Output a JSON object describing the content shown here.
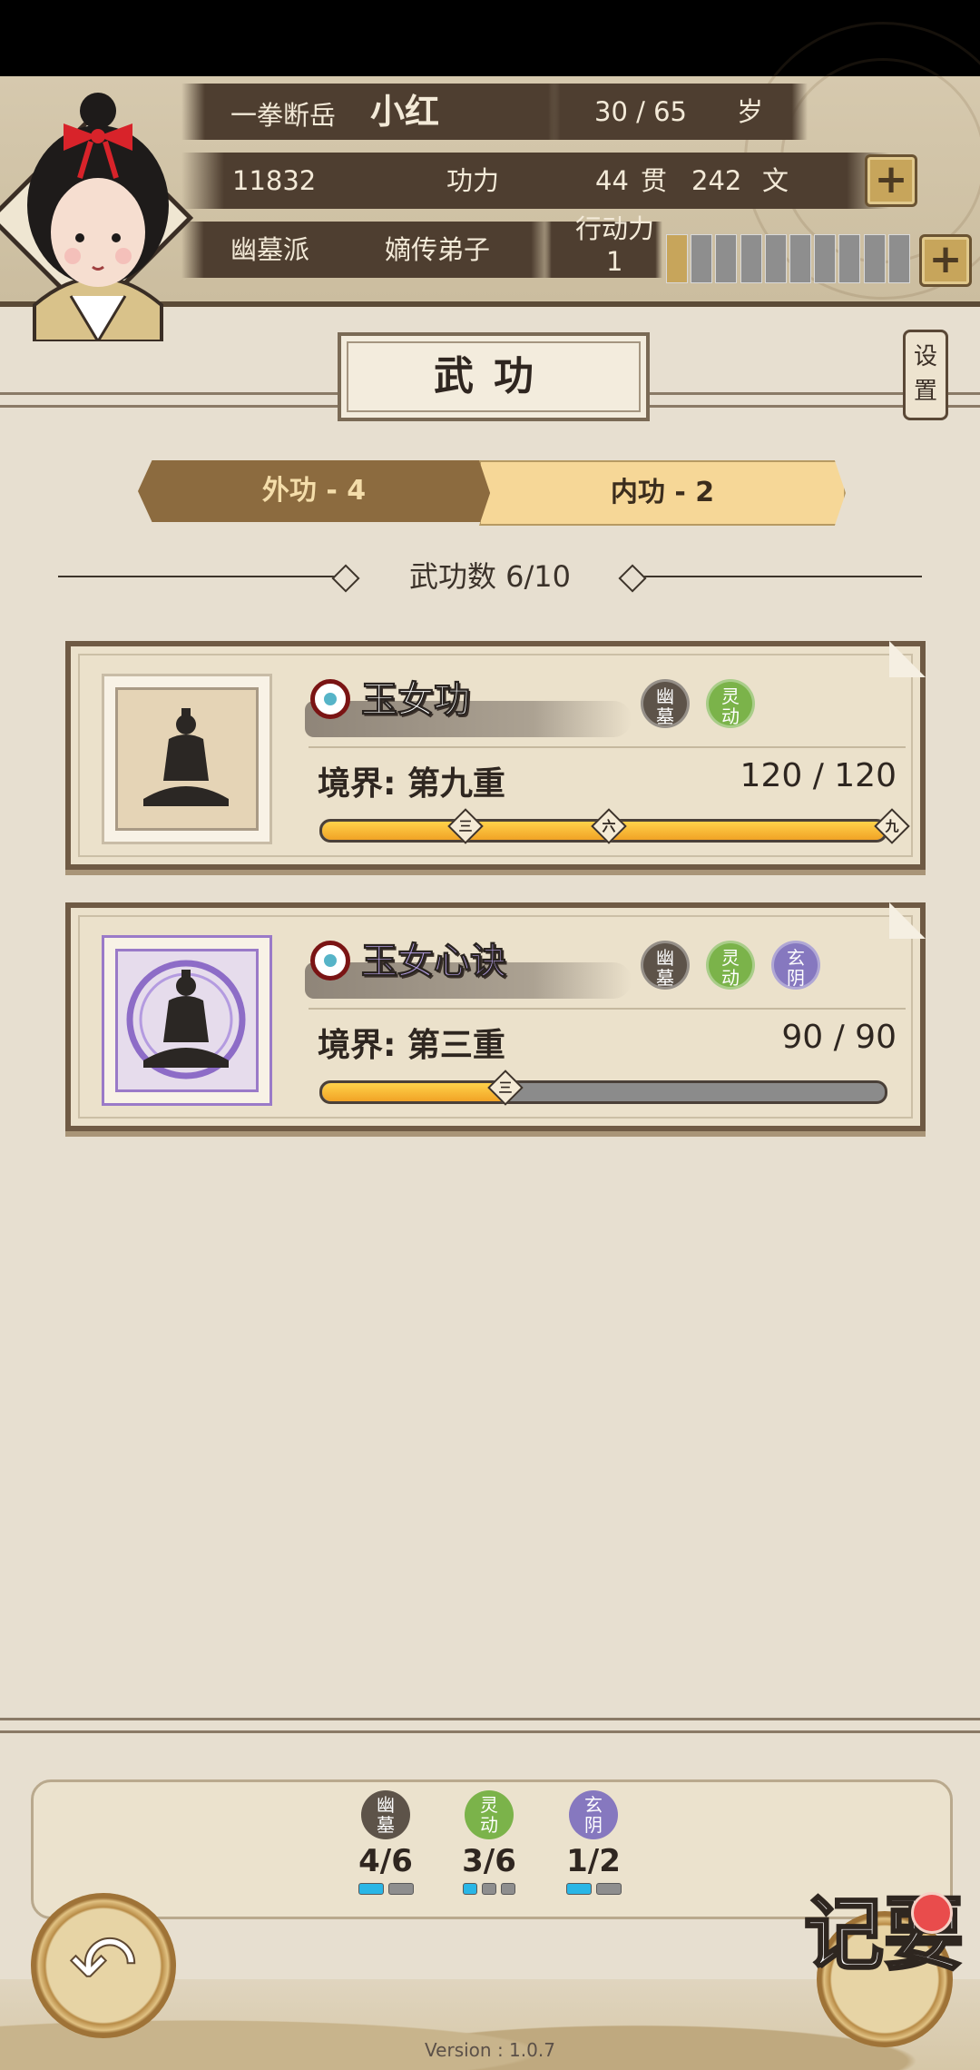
{
  "header": {
    "title": "一拳断岳",
    "name": "小红",
    "age": "30 / 65",
    "age_unit": "岁",
    "power_value": "11832",
    "power_label": "功力",
    "money_guan": "44",
    "guan_unit": "贯",
    "money_wen": "242",
    "wen_unit": "文",
    "sect": "幽墓派",
    "rank": "嫡传弟子",
    "action_label": "行动力",
    "action_value": "1",
    "action_cells_total": 10,
    "action_cells_filled": 1,
    "plus_symbol": "+"
  },
  "settings_label": "设置",
  "page_title": "武功",
  "tabs": [
    {
      "label": "外功 - 4",
      "active": false
    },
    {
      "label": "内功 - 2",
      "active": true
    }
  ],
  "skill_count": "武功数 6/10",
  "skills": [
    {
      "name": "玉女功",
      "name_color": "#ffffff",
      "badges": [
        {
          "label": "幽墓",
          "color": "#5d5349"
        },
        {
          "label": "灵动",
          "color": "#7bb34a"
        }
      ],
      "realm": "境界: 第九重",
      "progress": "120 / 120",
      "level_fraction": 1.0,
      "markers": [
        "三",
        "六",
        "九"
      ]
    },
    {
      "name": "玉女心诀",
      "name_color": "#b6a0e6",
      "badges": [
        {
          "label": "幽墓",
          "color": "#5d5349"
        },
        {
          "label": "灵动",
          "color": "#7bb34a"
        },
        {
          "label": "玄阴",
          "color": "#8678bf"
        }
      ],
      "realm": "境界: 第三重",
      "progress": "90 / 90",
      "level_fraction": 0.33,
      "markers": [
        "三"
      ]
    }
  ],
  "bottom_stats": [
    {
      "icon": "幽墓",
      "color": "#5d5349",
      "value": "4/6",
      "pips_on": 1,
      "pips_total": 2
    },
    {
      "icon": "灵动",
      "color": "#7bb34a",
      "value": "3/6",
      "pips_on": 1,
      "pips_total": 3
    },
    {
      "icon": "玄阴",
      "color": "#8678bf",
      "value": "1/2",
      "pips_on": 1,
      "pips_total": 2
    }
  ],
  "back_icon": "↶",
  "notes_label": "记要",
  "version": "Version : 1.0.7"
}
